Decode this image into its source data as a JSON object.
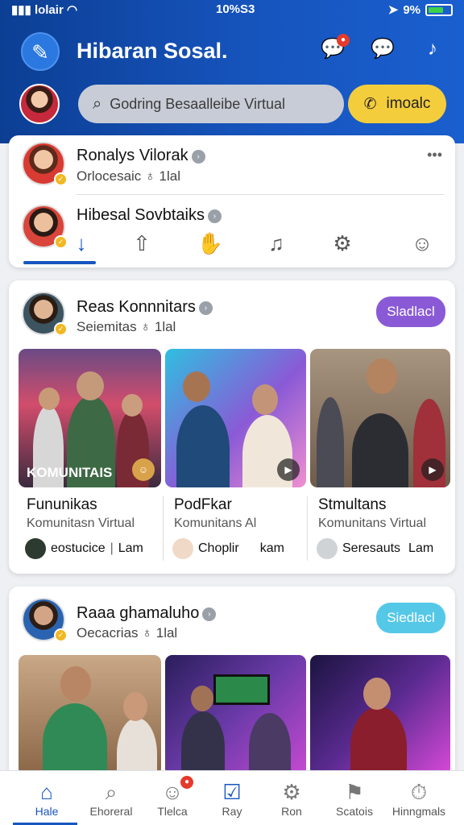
{
  "status_bar": {
    "carrier": "lolair",
    "time": "10%S3",
    "battery": "9%"
  },
  "header": {
    "title": "Hibaran Sosal.",
    "search_placeholder": "Godring Besaalleibe Virtual",
    "action_button": "imoalc"
  },
  "card1": {
    "row1": {
      "name": "Ronalys Vilorak",
      "sub": "Orlocesaic",
      "time": "1lal",
      "more": "•••"
    },
    "row2": {
      "name": "Hibesal Sovbtaiks"
    },
    "tabs": [
      "download-icon",
      "upload-icon",
      "hand-icon",
      "music-icon",
      "gear-icon"
    ]
  },
  "card2": {
    "name": "Reas Konnnitars",
    "sub": "Seiemitas",
    "time": "1lal",
    "follow_button": "Sladlacl",
    "follow_color": "#8a5ad6",
    "tile_caption": "KOMUNITAIS",
    "columns": [
      {
        "title": "Fununikas",
        "sub": "Komunitasn Virtual",
        "user": "eostucice",
        "extra": "Lam"
      },
      {
        "title": "PodFkar",
        "sub": "Komunitans Al",
        "user": "Choplir",
        "extra": "kam"
      },
      {
        "title": "Stmultans",
        "sub": "Komunitans Virtual",
        "user": "Seresauts",
        "extra": "Lam"
      }
    ]
  },
  "card3": {
    "name": "Raaa ghamaluho",
    "sub": "Oecacrias",
    "time": "1lal",
    "follow_button": "Siedlacl",
    "follow_color": "#55c8e8"
  },
  "bottom_nav": [
    {
      "label": "Hale",
      "icon": "home-icon"
    },
    {
      "label": "Ehoreral",
      "icon": "search-icon"
    },
    {
      "label": "Tlelca",
      "icon": "profile-icon"
    },
    {
      "label": "Ray",
      "icon": "check-icon"
    },
    {
      "label": "Ron",
      "icon": "gear-icon"
    },
    {
      "label": "Scatois",
      "icon": "flag-icon"
    },
    {
      "label": "Hinngmals",
      "icon": "timer-icon"
    }
  ]
}
